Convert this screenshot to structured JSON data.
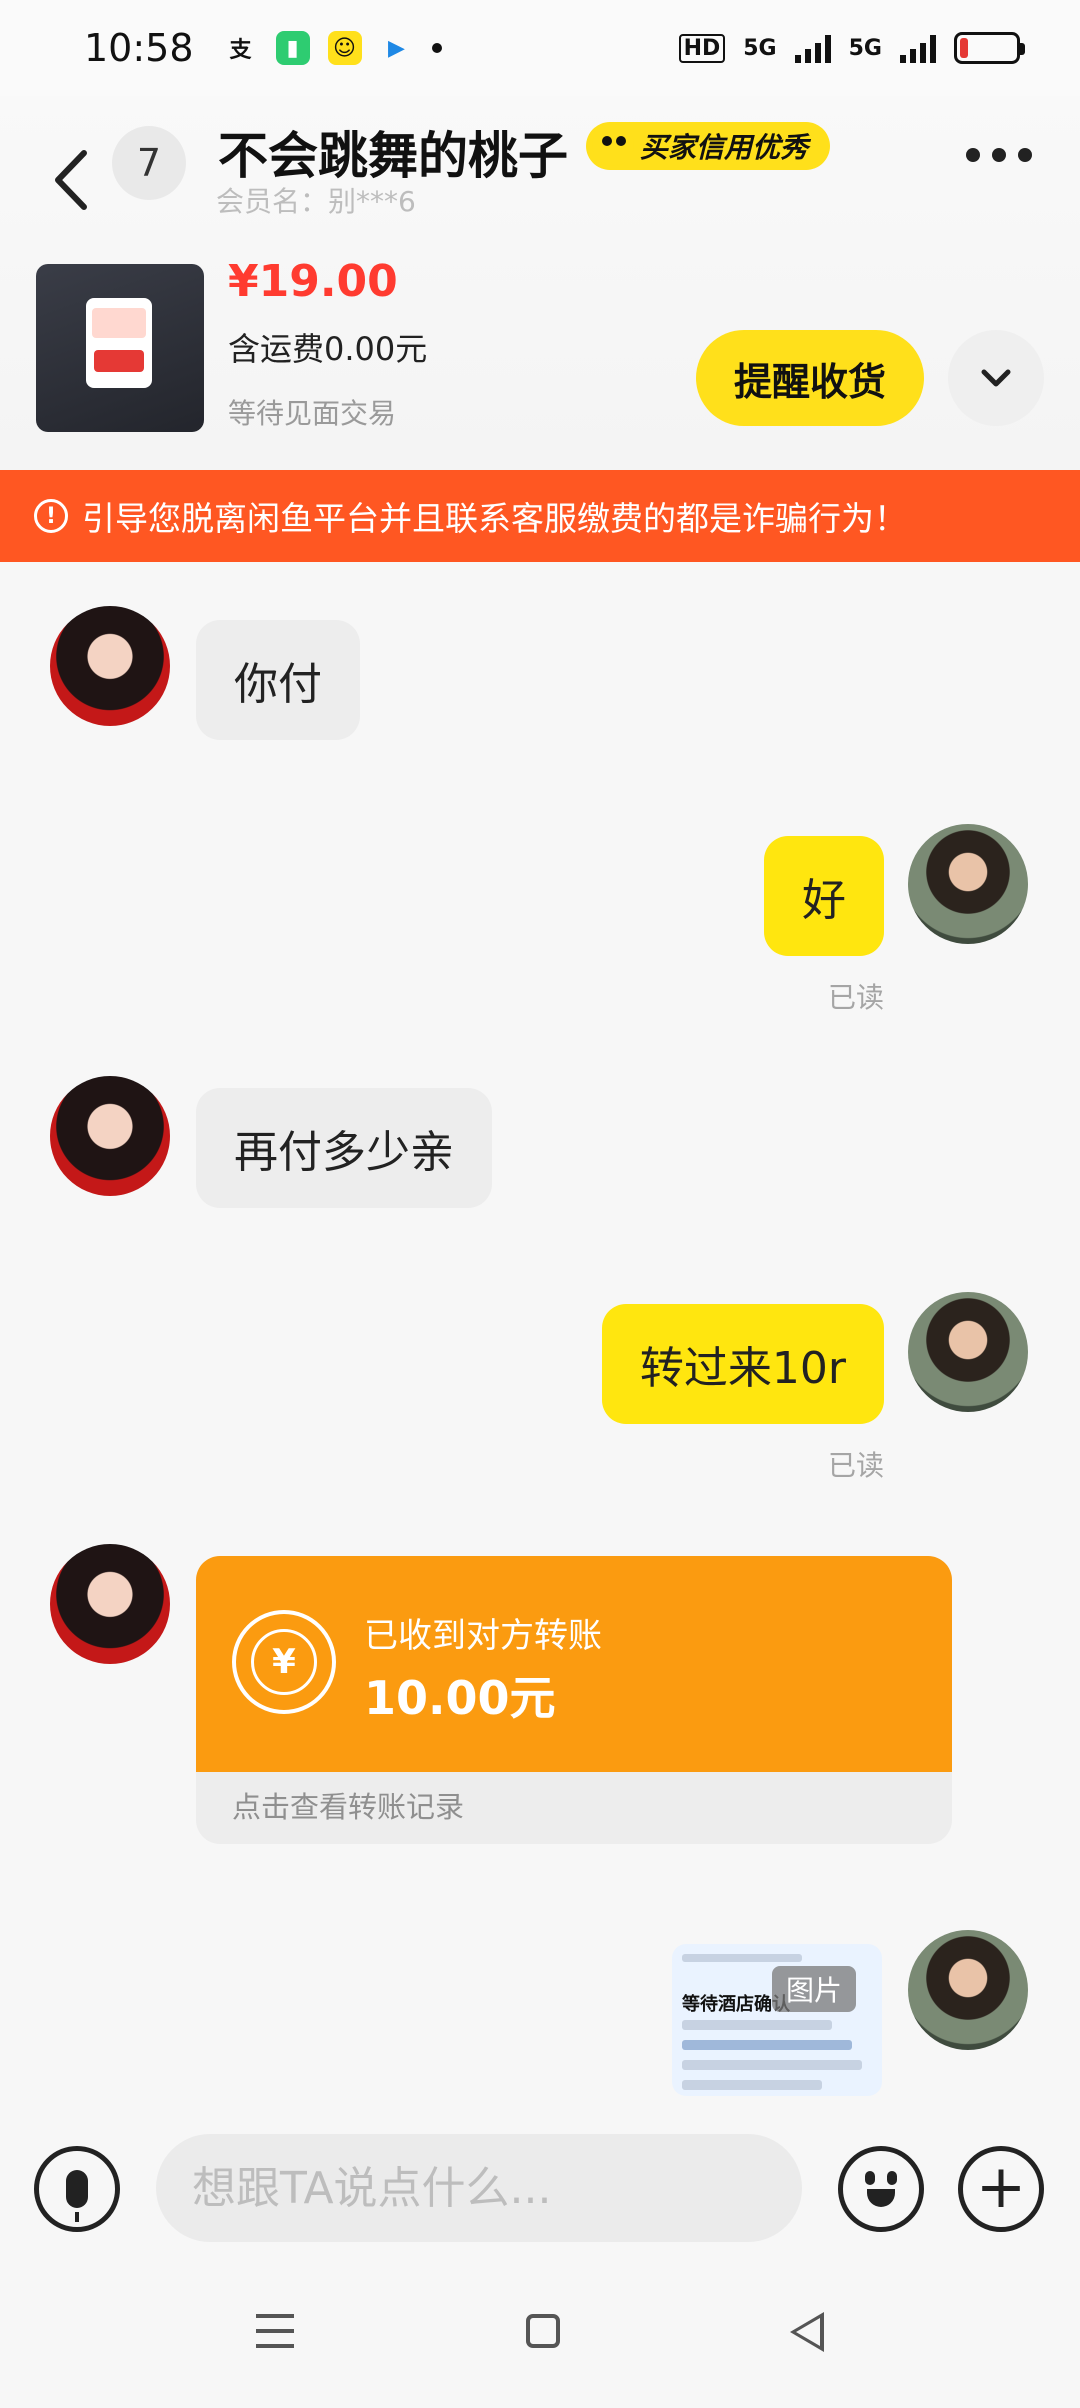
{
  "status_bar": {
    "time": "10:58",
    "app_icons": [
      "alipay-icon",
      "battery-app-icon",
      "cartoon-app-icon",
      "play-app-icon",
      "notification-dot"
    ],
    "net_hd": "HD",
    "net_5g_1": "5G",
    "net_5g_2": "5G",
    "battery_level": 0.15
  },
  "header": {
    "unread_count": "7",
    "contact_name": "不会跳舞的桃子",
    "credit_badge": "买家信用优秀",
    "member_name": "会员名：别***6"
  },
  "product": {
    "price": "¥19.00",
    "shipping": "含运费0.00元",
    "status": "等待见面交易",
    "remind_button": "提醒收货"
  },
  "warning": {
    "text": "引导您脱离闲鱼平台并且联系客服缴费的都是诈骗行为！"
  },
  "messages": [
    {
      "from": "them",
      "text": "你付"
    },
    {
      "from": "me",
      "text": "好",
      "read": "已读"
    },
    {
      "from": "them",
      "text": "再付多少亲"
    },
    {
      "from": "me",
      "text": "转过来10r",
      "read": "已读"
    }
  ],
  "transfer": {
    "title": "已收到对方转账",
    "amount": "10.00元",
    "link": "点击查看转账记录"
  },
  "image_message": {
    "tag": "图片",
    "preview_title": "等待酒店确认"
  },
  "input_bar": {
    "placeholder": "想跟TA说点什么..."
  },
  "colors": {
    "accent_yellow": "#ffe01b",
    "warning_orange": "#ff5722",
    "transfer_orange": "#fb9b10",
    "price_red": "#ff3b30"
  }
}
